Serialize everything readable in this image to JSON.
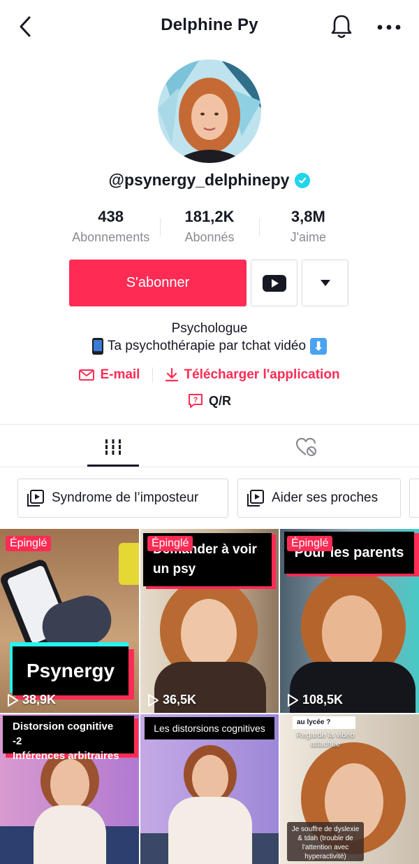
{
  "header": {
    "title": "Delphine Py"
  },
  "profile": {
    "username": "@psynergy_delphinepy",
    "verified": true,
    "stats": [
      {
        "value": "438",
        "label": "Abonnements"
      },
      {
        "value": "181,2K",
        "label": "Abonnés"
      },
      {
        "value": "3,8M",
        "label": "J'aime"
      }
    ],
    "follow_label": "S'abonner",
    "bio_line1": "Psychologue",
    "bio_line2": "Ta psychothérapie par tchat vidéo",
    "email_label": "E-mail",
    "download_label": "Télécharger l'application",
    "qr_label": "Q/R"
  },
  "playlists": [
    {
      "label": "Syndrome de l’imposteur"
    },
    {
      "label": "Aider ses proches"
    }
  ],
  "videos": [
    {
      "pinned": "Épinglé",
      "views": "38,9K",
      "caption": "Psynergy"
    },
    {
      "pinned": "Épinglé",
      "views": "36,5K",
      "caption_line1": "Demander à voir",
      "caption_line2": "un psy"
    },
    {
      "pinned": "Épinglé",
      "views": "108,5K",
      "caption": "Pour les parents"
    },
    {
      "caption_line1": "Distorsion cognitive -2",
      "caption_line2": "Inférences arbitraires"
    },
    {
      "caption": "Les distorsions cognitives"
    },
    {
      "caption_top": "au lycée ?",
      "caption_mid": "Regarde la vidéo attachée",
      "caption_bottom": "Je souffre de dyslexie & tdah (trouble de l'attention avec hyperactivité)"
    }
  ],
  "colors": {
    "accent": "#fe2c55",
    "verified": "#20d5ec",
    "text": "#161823",
    "muted": "#8a8b91"
  }
}
